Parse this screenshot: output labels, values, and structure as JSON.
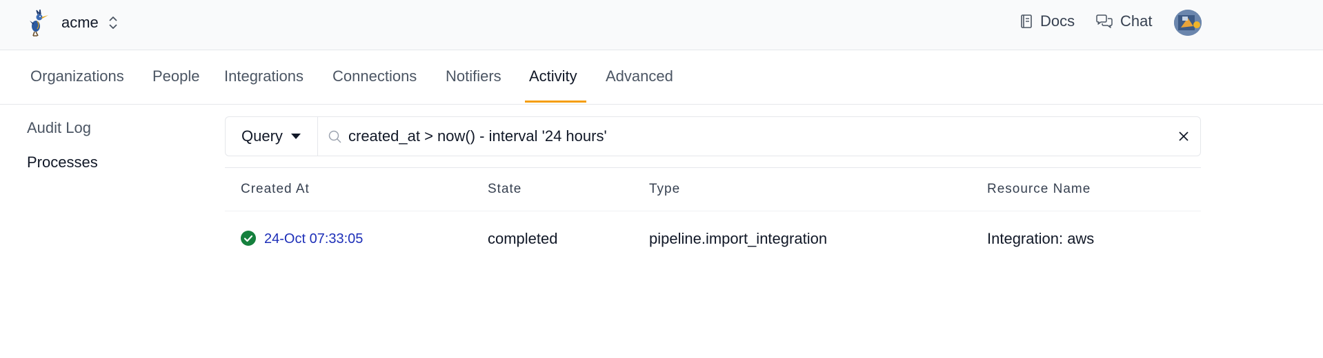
{
  "header": {
    "org_name": "acme",
    "logo_icon": "roadrunner-logo-icon",
    "switch_icon": "chevron-up-down-icon",
    "docs_label": "Docs",
    "chat_label": "Chat"
  },
  "tabs": [
    {
      "label": "Organizations",
      "active": false
    },
    {
      "label": "People",
      "active": false
    },
    {
      "label": "Integrations",
      "active": false
    },
    {
      "label": "Connections",
      "active": false
    },
    {
      "label": "Notifiers",
      "active": false
    },
    {
      "label": "Activity",
      "active": true
    },
    {
      "label": "Advanced",
      "active": false
    }
  ],
  "sidebar": {
    "items": [
      {
        "label": "Audit Log",
        "active": false
      },
      {
        "label": "Processes",
        "active": true
      }
    ]
  },
  "query": {
    "mode_label": "Query",
    "value": "created_at > now() - interval '24 hours'"
  },
  "table": {
    "columns": [
      "Created At",
      "State",
      "Type",
      "Resource Name"
    ],
    "rows": [
      {
        "status": "success",
        "created_at": "24-Oct 07:33:05",
        "state": "completed",
        "type": "pipeline.import_integration",
        "resource_name": "Integration: aws"
      }
    ]
  },
  "colors": {
    "accent": "#f59e0b",
    "link": "#1d2fb8",
    "success": "#15803d"
  }
}
